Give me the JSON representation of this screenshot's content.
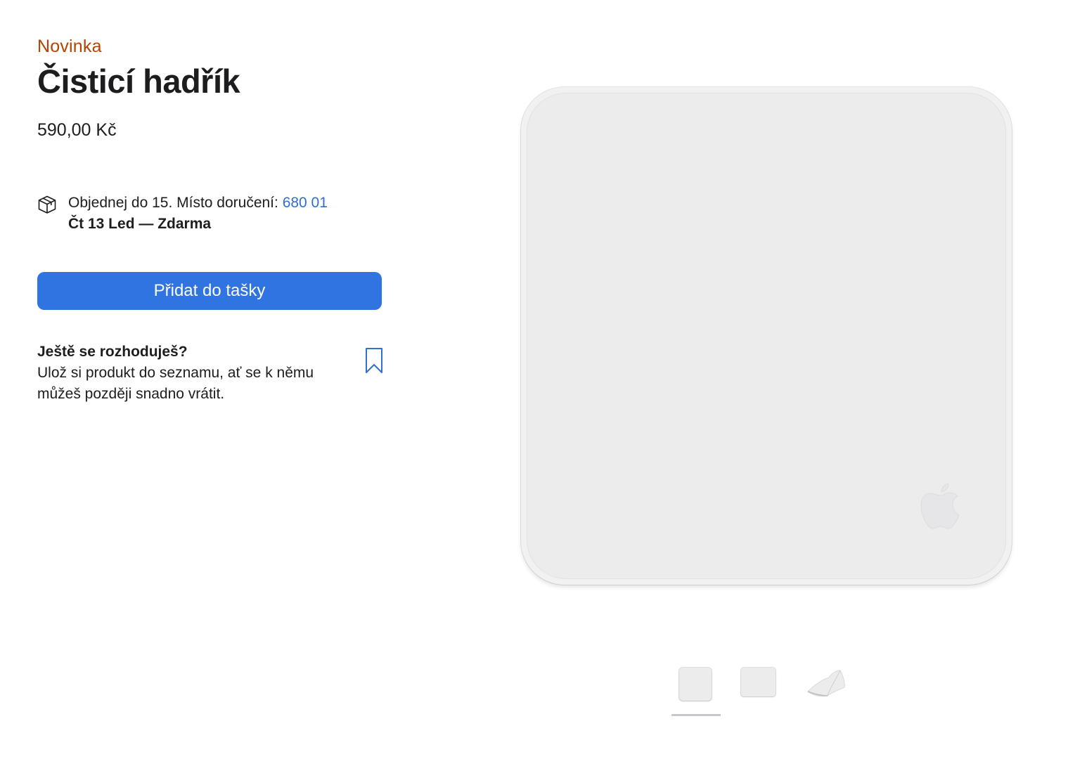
{
  "product": {
    "badge": "Novinka",
    "title": "Čisticí hadřík",
    "price": "590,00 Kč"
  },
  "delivery": {
    "icon": "box-icon",
    "order_text": "Objednej do 15. Místo doručení: ",
    "zip": "680 01",
    "date_text": "Čt 13 Led — Zdarma"
  },
  "cart": {
    "add_label": "Přidat do tašky"
  },
  "save": {
    "title": "Ještě se rozhoduješ?",
    "text": "Ulož si produkt do seznamu, ať se k němu můžeš později snadno vrátit.",
    "icon": "bookmark-icon"
  },
  "gallery": {
    "selected_index": 0,
    "thumbnails": [
      "thumbnail-1",
      "thumbnail-2",
      "thumbnail-3"
    ]
  },
  "colors": {
    "badge": "#b64400",
    "link": "#2f6fcf",
    "button": "#2f74e0"
  }
}
